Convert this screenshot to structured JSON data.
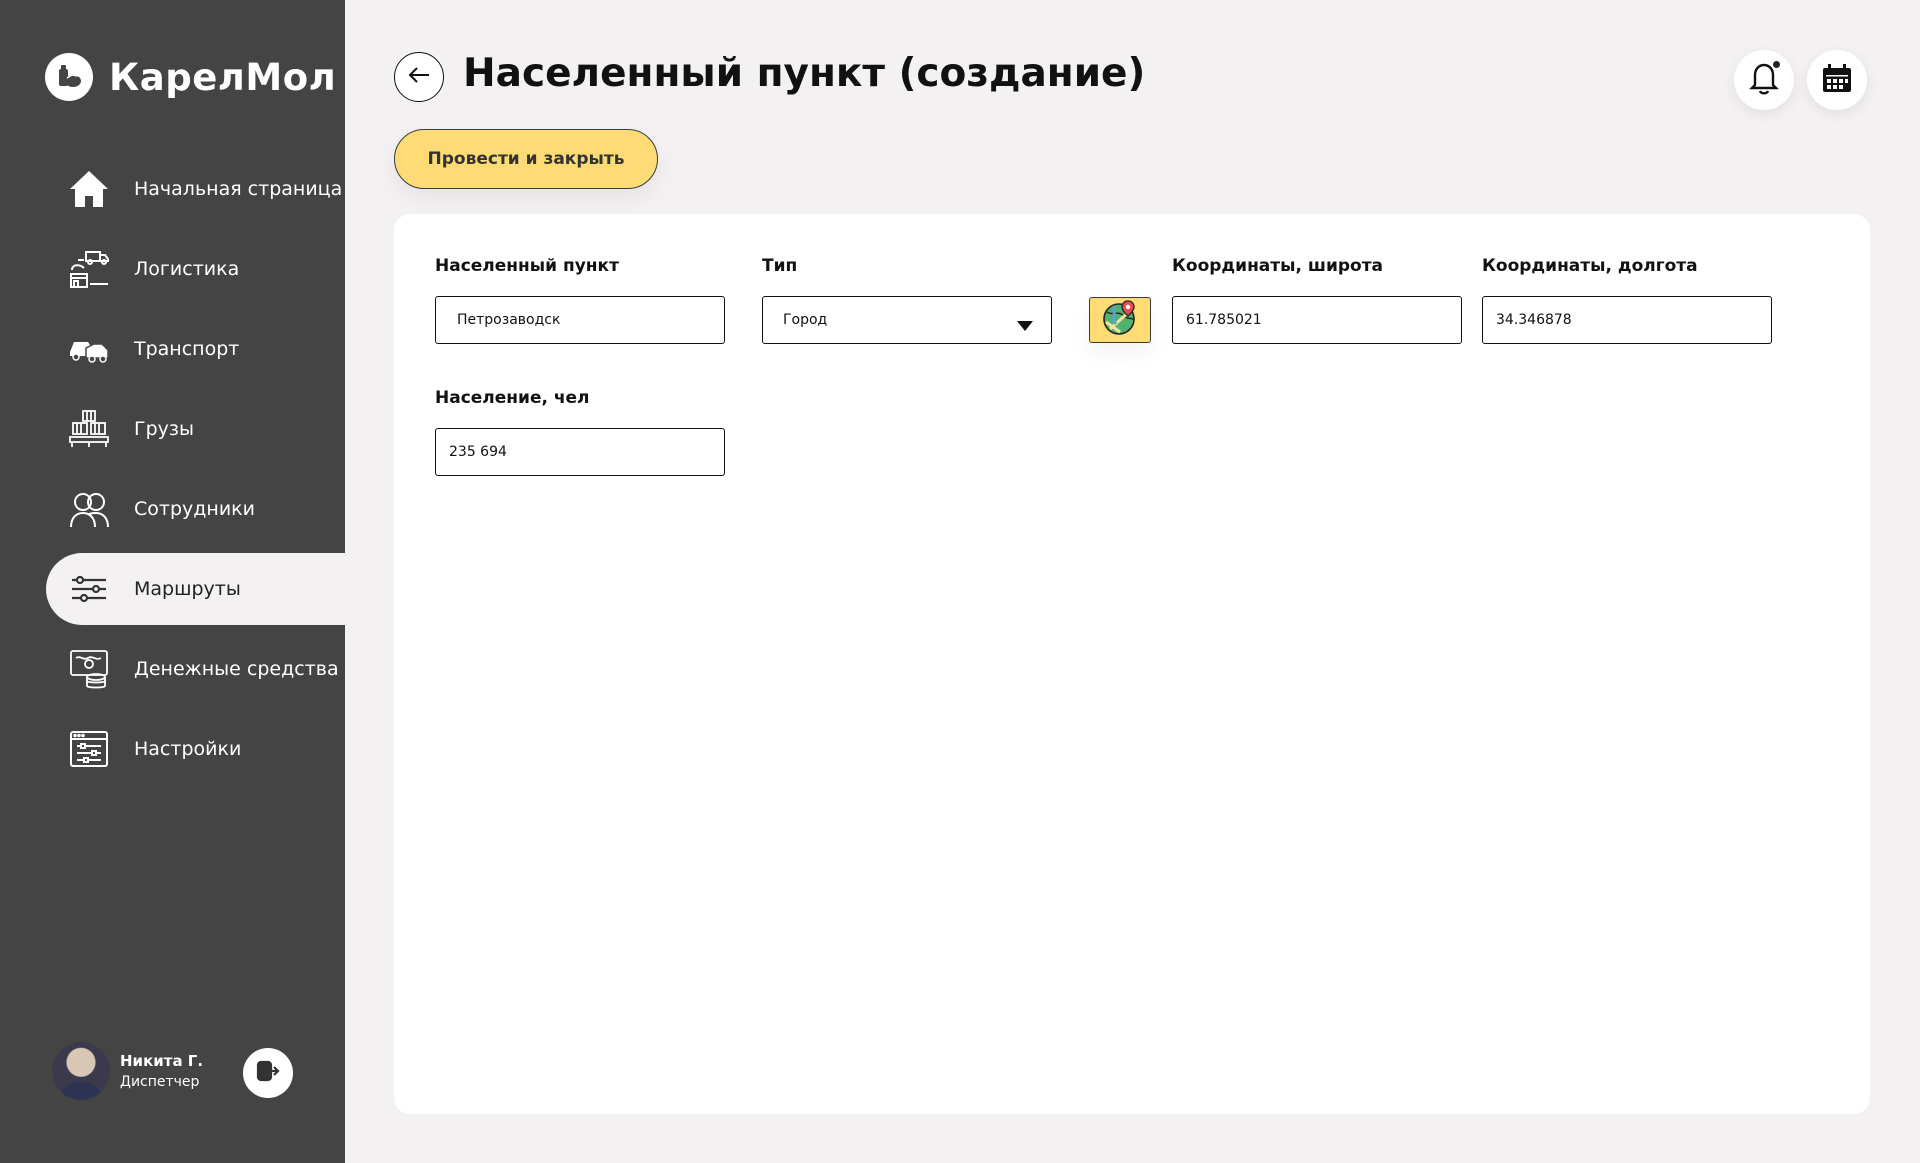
{
  "app": {
    "brand_name": "КарелМол"
  },
  "sidebar": {
    "items": [
      {
        "label": "Начальная страница",
        "icon": "home-icon"
      },
      {
        "label": "Логистика",
        "icon": "logistics-icon"
      },
      {
        "label": "Транспорт",
        "icon": "transport-icon"
      },
      {
        "label": "Грузы",
        "icon": "cargo-icon"
      },
      {
        "label": "Сотрудники",
        "icon": "employees-icon"
      },
      {
        "label": "Маршруты",
        "icon": "routes-icon",
        "active": true
      },
      {
        "label": "Денежные средства",
        "icon": "money-icon"
      },
      {
        "label": "Настройки",
        "icon": "settings-icon"
      }
    ],
    "user": {
      "name": "Никита Г.",
      "role": "Диспетчер"
    }
  },
  "header": {
    "title": "Населенный пункт (создание)",
    "submit_label": "Провести и закрыть"
  },
  "form": {
    "settlement": {
      "label": "Населенный пункт",
      "value": "Петрозаводск"
    },
    "type": {
      "label": "Тип",
      "value": "Город"
    },
    "latitude": {
      "label": "Координаты, широта",
      "value": "61.785021"
    },
    "longitude": {
      "label": "Координаты, долгота",
      "value": "34.346878"
    },
    "population": {
      "label": "Население, чел",
      "value": "235 694"
    }
  },
  "colors": {
    "sidebar_bg": "#444444",
    "page_bg": "#f4f1f3",
    "accent": "#fedb74",
    "card_bg": "#ffffff"
  }
}
